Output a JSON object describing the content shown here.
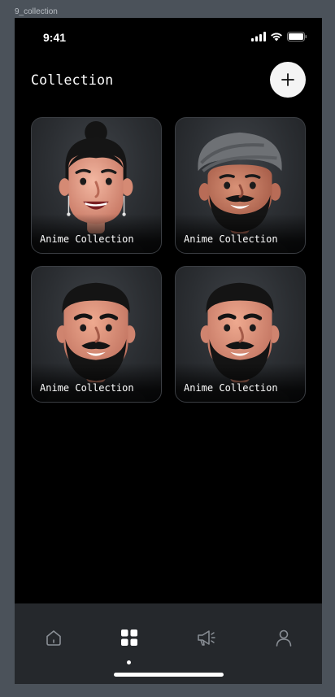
{
  "frame": {
    "label": "9_collection"
  },
  "status_bar": {
    "time": "9:41"
  },
  "header": {
    "title": "Collection"
  },
  "collections": [
    {
      "label": "Anime Collection",
      "avatar": "avatar-bun-earrings"
    },
    {
      "label": "Anime Collection",
      "avatar": "avatar-turban-beard"
    },
    {
      "label": "Anime Collection",
      "avatar": "avatar-beard"
    },
    {
      "label": "Anime Collection",
      "avatar": "avatar-beard"
    }
  ],
  "bottom_nav": {
    "items": [
      {
        "icon": "home-icon",
        "active": false
      },
      {
        "icon": "grid-icon",
        "active": true
      },
      {
        "icon": "megaphone-icon",
        "active": false
      },
      {
        "icon": "user-icon",
        "active": false
      }
    ]
  },
  "colors": {
    "background": "#000000",
    "nav_background": "#25282c",
    "card_border": "#3b3e43",
    "add_button": "#f4f4f4",
    "inactive_icon": "#8a8f96"
  }
}
